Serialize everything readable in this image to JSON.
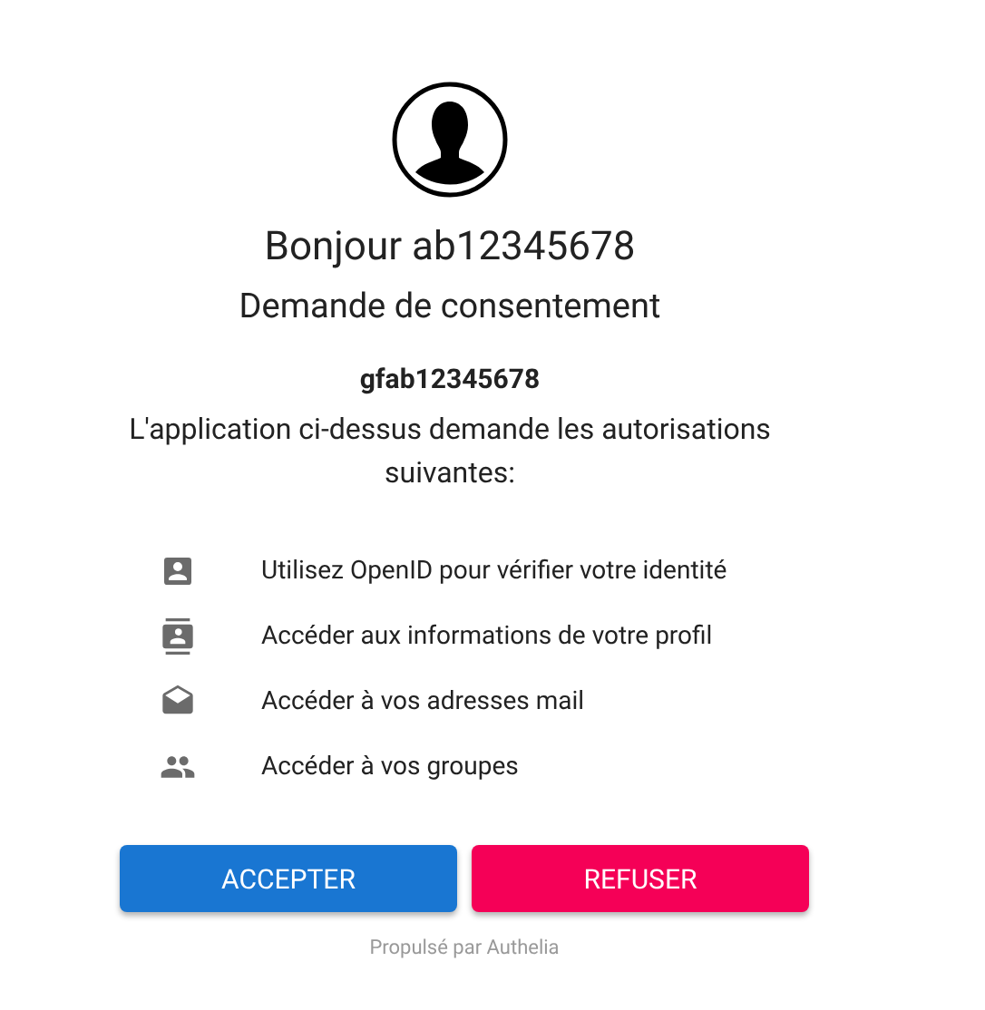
{
  "greeting": "Bonjour ab12345678",
  "subtitle": "Demande de consentement",
  "client": "gfab12345678",
  "description": "L'application ci-dessus demande les autorisations suivantes:",
  "scopes": [
    {
      "kind": "identity",
      "label": "Utilisez OpenID pour vérifier votre identité"
    },
    {
      "kind": "profile",
      "label": "Accéder aux informations de votre profil"
    },
    {
      "kind": "email",
      "label": "Accéder à vos adresses mail"
    },
    {
      "kind": "groups",
      "label": "Accéder à vos groupes"
    }
  ],
  "buttons": [
    {
      "kind": "accept",
      "label": "ACCEPTER"
    },
    {
      "kind": "deny",
      "label": "REFUSER"
    }
  ],
  "footer": "Propulsé par Authelia"
}
